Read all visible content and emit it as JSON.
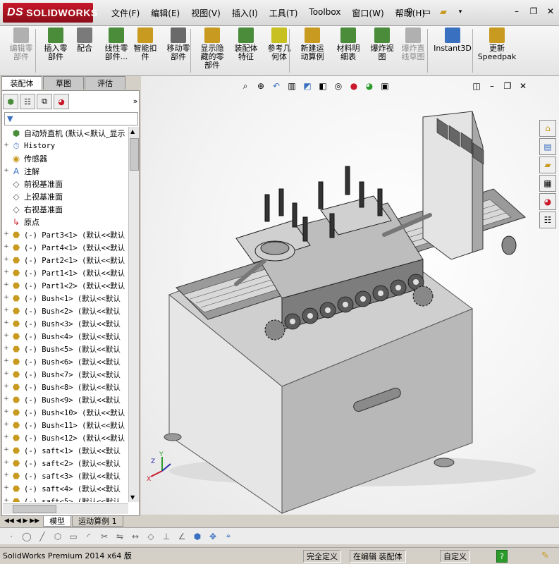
{
  "app": {
    "logo_text": "SOLIDWORKS",
    "logo_prefix": "DS"
  },
  "menu": [
    {
      "id": "file",
      "label": "文件(F)"
    },
    {
      "id": "edit",
      "label": "编辑(E)"
    },
    {
      "id": "view",
      "label": "视图(V)"
    },
    {
      "id": "insert",
      "label": "插入(I)"
    },
    {
      "id": "tools",
      "label": "工具(T)"
    },
    {
      "id": "toolbox",
      "label": "Toolbox"
    },
    {
      "id": "window",
      "label": "窗口(W)"
    },
    {
      "id": "help",
      "label": "帮助(H)"
    }
  ],
  "toolbar": [
    {
      "id": "edit-component",
      "label": "编辑零\n部件",
      "icon": "edit-component-icon",
      "disabled": true,
      "color": "#b0b0b0"
    },
    {
      "id": "insert-component",
      "label": "插入零\n部件",
      "icon": "insert-component-icon",
      "disabled": false,
      "color": "#4a8c3a"
    },
    {
      "id": "mate",
      "label": "配合",
      "icon": "mate-icon",
      "disabled": false,
      "color": "#7a7a7a"
    },
    {
      "id": "linear-pattern",
      "label": "线性零\n部件...",
      "icon": "linear-pattern-icon",
      "disabled": false,
      "color": "#4a8c3a"
    },
    {
      "id": "smart-fastener",
      "label": "智能扣\n件",
      "icon": "smart-fastener-icon",
      "disabled": false,
      "color": "#c89a20"
    },
    {
      "id": "move-component",
      "label": "移动零\n部件",
      "icon": "move-component-icon",
      "disabled": false,
      "color": "#6a6a6a"
    },
    {
      "id": "show-hidden",
      "label": "显示隐\n藏的零\n部件",
      "icon": "show-hidden-icon",
      "disabled": false,
      "color": "#c89a20"
    },
    {
      "id": "assembly-feature",
      "label": "装配体\n特征",
      "icon": "assembly-feature-icon",
      "disabled": false,
      "color": "#4a8c3a"
    },
    {
      "id": "reference-geometry",
      "label": "参考几\n何体",
      "icon": "reference-geometry-icon",
      "disabled": false,
      "color": "#c8c020"
    },
    {
      "id": "new-motion-study",
      "label": "新建运\n动算例",
      "icon": "motion-study-icon",
      "disabled": false,
      "color": "#c89a20"
    },
    {
      "id": "bom",
      "label": "材料明\n细表",
      "icon": "bom-icon",
      "disabled": false,
      "color": "#4a8c3a"
    },
    {
      "id": "exploded-view",
      "label": "爆炸视\n图",
      "icon": "exploded-view-icon",
      "disabled": false,
      "color": "#4a8c3a"
    },
    {
      "id": "explode-line",
      "label": "爆炸直\n线草图",
      "icon": "explode-line-icon",
      "disabled": true,
      "color": "#b0b0b0"
    },
    {
      "id": "instant3d",
      "label": "Instant3D",
      "icon": "instant3d-icon",
      "disabled": false,
      "color": "#3a70c0"
    },
    {
      "id": "speedpak",
      "label": "更新\nSpeedpak",
      "icon": "speedpak-icon",
      "disabled": false,
      "color": "#c89a20"
    }
  ],
  "panel_tabs": [
    {
      "id": "assembly",
      "label": "装配体",
      "active": true
    },
    {
      "id": "sketch",
      "label": "草图",
      "active": false
    },
    {
      "id": "evaluate",
      "label": "评估",
      "active": false
    }
  ],
  "tree": [
    {
      "expand": "",
      "icon": "assembly-icon",
      "text": "自动矫直机  (默认<默认_显示",
      "mono": false
    },
    {
      "expand": "+",
      "icon": "history-icon",
      "text": "History",
      "mono": true
    },
    {
      "expand": "",
      "icon": "sensor-icon",
      "text": "传感器",
      "mono": false
    },
    {
      "expand": "+",
      "icon": "annotation-icon",
      "text": "注解",
      "mono": false
    },
    {
      "expand": "",
      "icon": "plane-icon",
      "text": "前视基准面",
      "mono": false
    },
    {
      "expand": "",
      "icon": "plane-icon",
      "text": "上视基准面",
      "mono": false
    },
    {
      "expand": "",
      "icon": "plane-icon",
      "text": "右视基准面",
      "mono": false
    },
    {
      "expand": "",
      "icon": "origin-icon",
      "text": "原点",
      "mono": false
    },
    {
      "expand": "+",
      "icon": "part-icon",
      "text": "(-) Part3<1> (默认<<默认",
      "mono": true
    },
    {
      "expand": "+",
      "icon": "part-icon",
      "text": "(-) Part4<1> (默认<<默认",
      "mono": true
    },
    {
      "expand": "+",
      "icon": "part-icon",
      "text": "(-) Part2<1> (默认<<默认",
      "mono": true
    },
    {
      "expand": "+",
      "icon": "part-icon",
      "text": "(-) Part1<1> (默认<<默认",
      "mono": true
    },
    {
      "expand": "+",
      "icon": "part-icon",
      "text": "(-) Part1<2> (默认<<默认",
      "mono": true
    },
    {
      "expand": "+",
      "icon": "part-icon",
      "text": "(-) Bush<1> (默认<<默认",
      "mono": true
    },
    {
      "expand": "+",
      "icon": "part-icon",
      "text": "(-) Bush<2> (默认<<默认",
      "mono": true
    },
    {
      "expand": "+",
      "icon": "part-icon",
      "text": "(-) Bush<3> (默认<<默认",
      "mono": true
    },
    {
      "expand": "+",
      "icon": "part-icon",
      "text": "(-) Bush<4> (默认<<默认",
      "mono": true
    },
    {
      "expand": "+",
      "icon": "part-icon",
      "text": "(-) Bush<5> (默认<<默认",
      "mono": true
    },
    {
      "expand": "+",
      "icon": "part-icon",
      "text": "(-) Bush<6> (默认<<默认",
      "mono": true
    },
    {
      "expand": "+",
      "icon": "part-icon",
      "text": "(-) Bush<7> (默认<<默认",
      "mono": true
    },
    {
      "expand": "+",
      "icon": "part-icon",
      "text": "(-) Bush<8> (默认<<默认",
      "mono": true
    },
    {
      "expand": "+",
      "icon": "part-icon",
      "text": "(-) Bush<9> (默认<<默认",
      "mono": true
    },
    {
      "expand": "+",
      "icon": "part-icon",
      "text": "(-) Bush<10> (默认<<默认",
      "mono": true
    },
    {
      "expand": "+",
      "icon": "part-icon",
      "text": "(-) Bush<11> (默认<<默认",
      "mono": true
    },
    {
      "expand": "+",
      "icon": "part-icon",
      "text": "(-) Bush<12> (默认<<默认",
      "mono": true
    },
    {
      "expand": "+",
      "icon": "part-icon",
      "text": "(-) saft<1> (默认<<默认",
      "mono": true
    },
    {
      "expand": "+",
      "icon": "part-icon",
      "text": "(-) saft<2> (默认<<默认",
      "mono": true
    },
    {
      "expand": "+",
      "icon": "part-icon",
      "text": "(-) saft<3> (默认<<默认",
      "mono": true
    },
    {
      "expand": "+",
      "icon": "part-icon",
      "text": "(-) saft<4> (默认<<默认",
      "mono": true
    },
    {
      "expand": "+",
      "icon": "part-icon",
      "text": "(-) saft<5> (默认<<默认",
      "mono": true
    }
  ],
  "bottom_tabs": [
    {
      "id": "model",
      "label": "模型",
      "active": true
    },
    {
      "id": "motion-study-1",
      "label": "运动算例 1",
      "active": false
    }
  ],
  "status": {
    "product": "SolidWorks Premium 2014 x64 版",
    "state": "完全定义",
    "editing": "在编辑 装配体",
    "units": "自定义",
    "help": "?"
  },
  "axis": {
    "x": "X",
    "y": "Y",
    "z": "Z"
  },
  "colors": {
    "brand": "#c8182a",
    "accent": "#3a70c0"
  }
}
